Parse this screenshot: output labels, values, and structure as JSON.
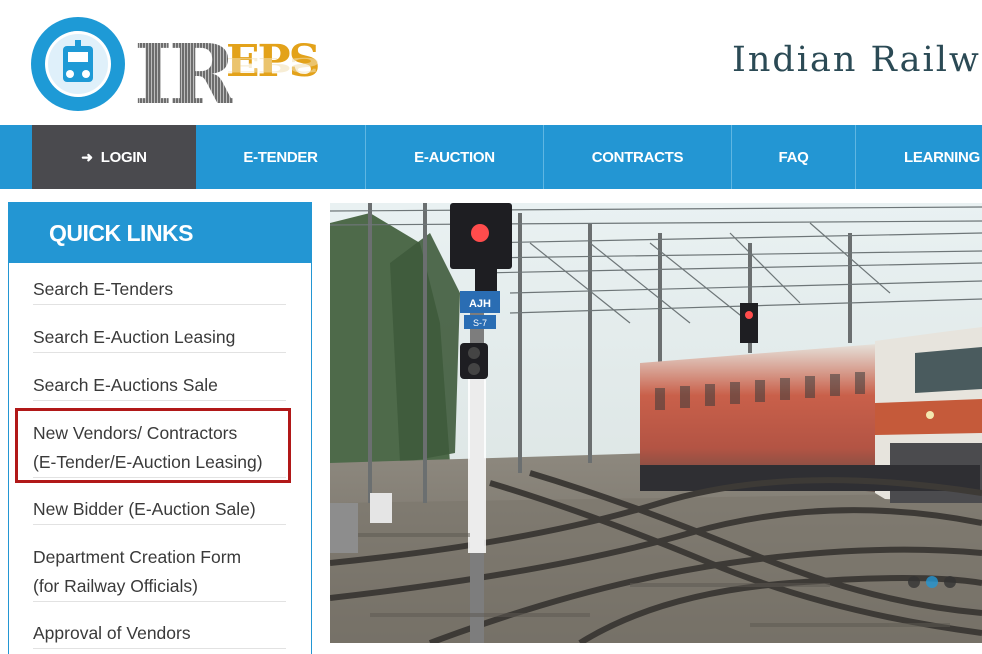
{
  "header": {
    "logo_ir": "IR",
    "logo_eps": "EPS",
    "title": "Indian Railwa"
  },
  "nav": {
    "items": [
      {
        "label": "LOGIN",
        "icon": "sign-in-icon"
      },
      {
        "label": "E-TENDER"
      },
      {
        "label": "E-AUCTION"
      },
      {
        "label": "CONTRACTS"
      },
      {
        "label": "FAQ"
      },
      {
        "label": "LEARNING"
      }
    ]
  },
  "quick_links": {
    "heading": "QUICK LINKS",
    "items": [
      {
        "line1": "Search E-Tenders",
        "line2": ""
      },
      {
        "line1": "Search E-Auction Leasing",
        "line2": ""
      },
      {
        "line1": "Search E-Auctions Sale",
        "line2": ""
      },
      {
        "line1": "New Vendors/ Contractors",
        "line2": "(E-Tender/E-Auction Leasing)"
      },
      {
        "line1": "New Bidder (E-Auction Sale)",
        "line2": ""
      },
      {
        "line1": "Department Creation Form",
        "line2": "(for Railway Officials)"
      },
      {
        "line1": "Approval of Vendors",
        "line2": ""
      }
    ],
    "highlighted_index": 3
  },
  "banner": {
    "signal_label_1": "AJH",
    "signal_label_2": "S-7",
    "slide_count": 3,
    "active_slide": 2
  },
  "colors": {
    "brand_blue": "#2396d3",
    "login_bg": "#4a4a4e",
    "highlight_red": "#b11818",
    "title_text": "#2b4a55",
    "eps_gold": "#e3a21a"
  }
}
